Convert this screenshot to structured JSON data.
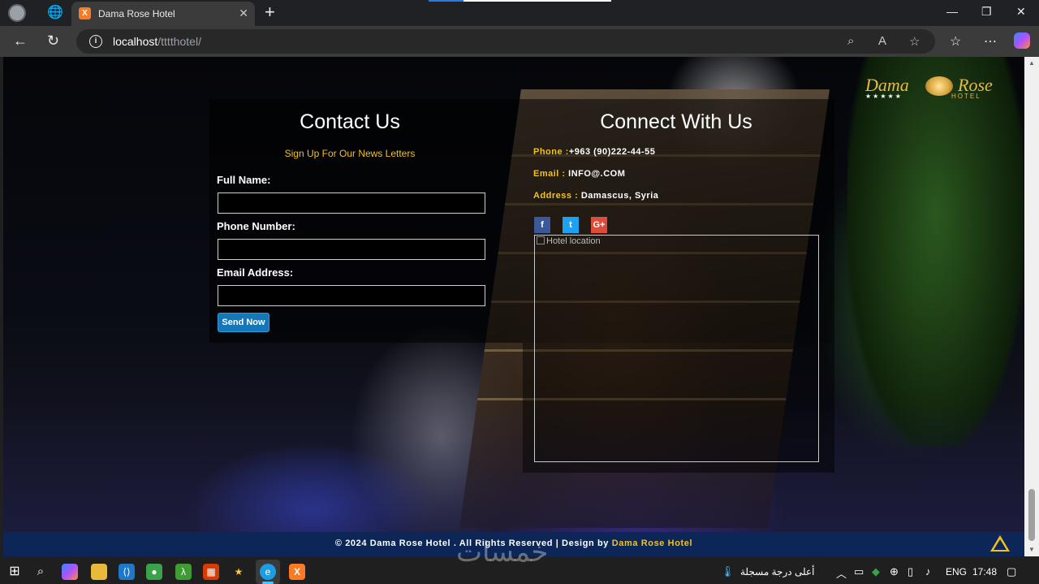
{
  "browser": {
    "tab_title": "Dama Rose Hotel",
    "url_host": "localhost",
    "url_path": "/tttthotel/"
  },
  "logo": {
    "name_left": "Dama",
    "name_right": "Rose",
    "sub": "HOTEL",
    "stars": "★★★★★"
  },
  "contact": {
    "title": "Contact Us",
    "newsletter": "Sign Up For Our News Letters",
    "fields": [
      {
        "label": "Full Name:",
        "value": ""
      },
      {
        "label": "Phone Number:",
        "value": ""
      },
      {
        "label": "Email Address:",
        "value": ""
      }
    ],
    "send_label": "Send Now"
  },
  "connect": {
    "title": "Connect With Us",
    "phone_key": "Phone :",
    "phone_val": "+963 (90)222-44-55",
    "email_key": "Email :",
    "email_val": "INFO@.COM",
    "address_key": "Address :",
    "address_val": "Damascus, Syria",
    "social": [
      {
        "icon": "facebook-icon",
        "glyph": "f",
        "color": "#3b5998"
      },
      {
        "icon": "twitter-icon",
        "glyph": "t",
        "color": "#1da1f2"
      },
      {
        "icon": "google-plus-icon",
        "glyph": "G+",
        "color": "#dd4b39"
      }
    ],
    "map_alt": "Hotel location"
  },
  "footer": {
    "text": "© 2024 Dama Rose Hotel . All Rights Reserved | Design by ",
    "brand": "Dama Rose Hotel"
  },
  "taskbar": {
    "weather": "أعلى درجة مسجلة",
    "lang": "ENG",
    "time": "17:48"
  },
  "watermark": "خمسات",
  "colors": {
    "accent": "#f2c21b",
    "footer_bg": "#0d2658",
    "button": "#1478b8"
  }
}
